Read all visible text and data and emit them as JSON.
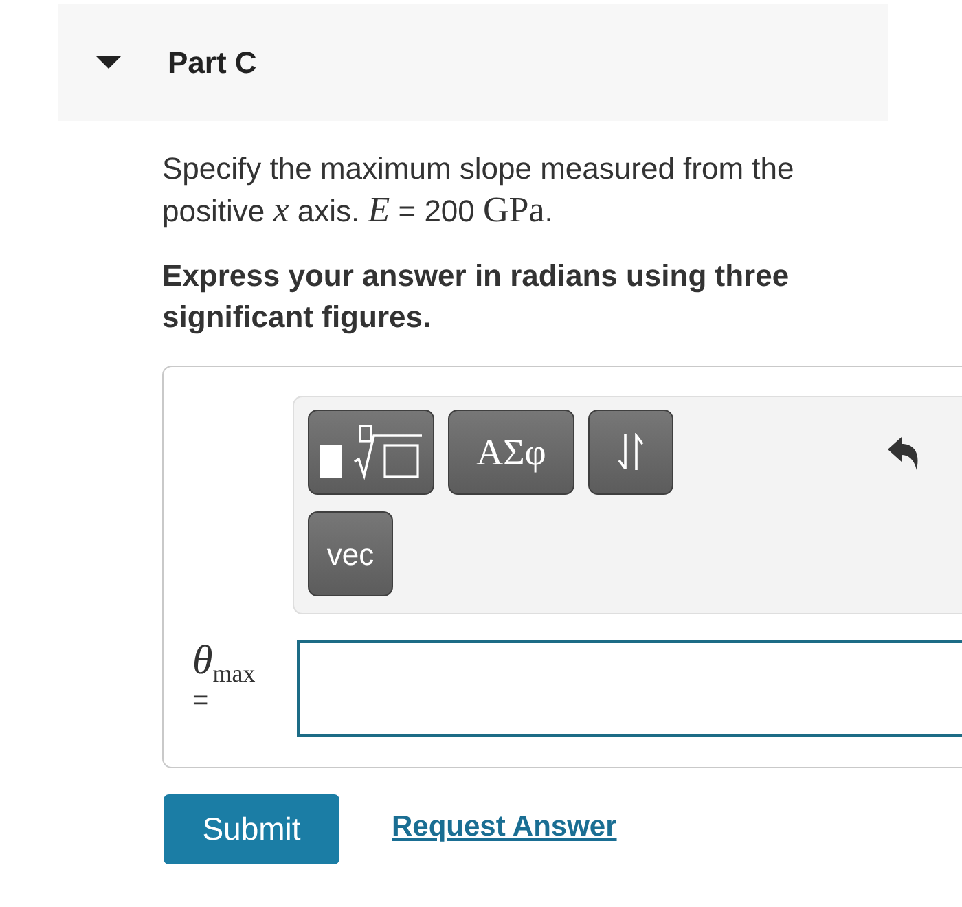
{
  "part": {
    "title": "Part C",
    "expanded": true
  },
  "prompt": [
    {
      "kind": "text",
      "text": "Specify the maximum slope measured from the positive "
    },
    {
      "kind": "variable",
      "text": "x"
    },
    {
      "kind": "text",
      "text": " axis. "
    },
    {
      "kind": "variable",
      "text": "E"
    },
    {
      "kind": "text",
      "text": " = 200 "
    },
    {
      "kind": "unit",
      "text": "GPa"
    },
    {
      "kind": "text",
      "text": "."
    }
  ],
  "instruction": "Express your answer in radians using three significant figures.",
  "toolbar": {
    "rows": [
      {
        "buttons": [
          {
            "kind": "templates"
          },
          {
            "kind": "symbols",
            "label": "ΑΣφ"
          },
          {
            "kind": "arrows"
          }
        ]
      },
      {
        "buttons": [
          {
            "kind": "text",
            "label": "vec"
          }
        ]
      }
    ]
  },
  "answer": {
    "symbol": "θ",
    "subscript": "max",
    "relation": "=",
    "focused": true
  },
  "actions": {
    "submit": "Submit",
    "request": "Request Answer"
  }
}
